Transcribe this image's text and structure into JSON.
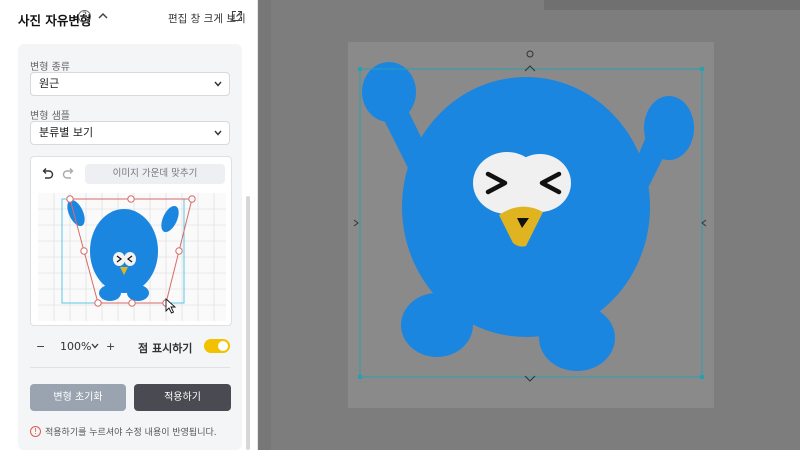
{
  "panel": {
    "title": "사진 자유변형",
    "help_glyph": "?",
    "editor_link": "편집 창 크게 보기"
  },
  "form": {
    "type_label": "변형 종류",
    "type_value": "원근",
    "sample_label": "변형 샘플",
    "sample_value": "분류별 보기"
  },
  "preview": {
    "center_button": "이미지 가운데 맞추기"
  },
  "zoom": {
    "minus": "−",
    "value": "100%",
    "plus": "+",
    "points_label": "점 표시하기",
    "points_on": true
  },
  "actions": {
    "reset": "변형 초기화",
    "apply": "적용하기",
    "notice": "적용하기를 누르셔야 수정 내용이 반영됩니다.",
    "notice_glyph": "!"
  },
  "colors": {
    "accent": "#f2c200",
    "character": "#1b86e0",
    "handles": "#2a9fb0"
  }
}
